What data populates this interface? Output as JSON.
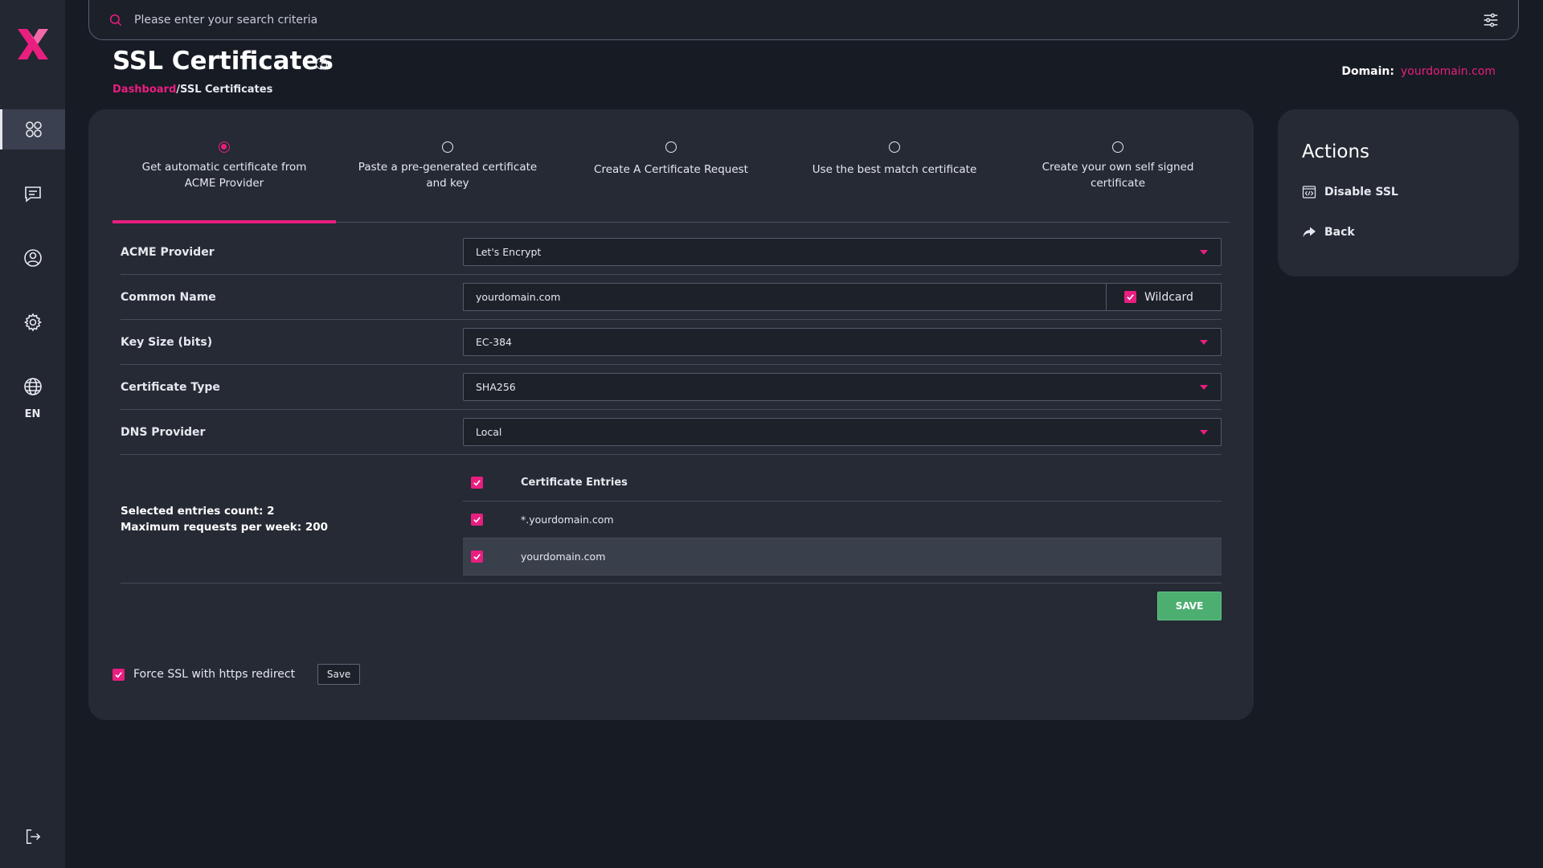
{
  "colors": {
    "accent": "#e91e7f",
    "save_green": "#4caf71",
    "background": "#171b24",
    "panel": "#252a34",
    "sidebar": "#222731"
  },
  "sidebar": {
    "logo_icon": "x-logo",
    "items": [
      {
        "name": "dashboard",
        "icon": "grid-icon",
        "active": true
      },
      {
        "name": "messages",
        "icon": "chat-icon",
        "active": false
      },
      {
        "name": "account",
        "icon": "user-icon",
        "active": false
      },
      {
        "name": "settings",
        "icon": "gear-icon",
        "active": false
      },
      {
        "name": "language",
        "icon": "globe-icon",
        "active": false
      }
    ],
    "language_label": "EN",
    "logout_icon": "logout-icon"
  },
  "search": {
    "placeholder": "Please enter your search criteria",
    "filter_icon": "sliders-icon"
  },
  "header": {
    "title": "SSL Certificates",
    "breadcrumb": {
      "link": "Dashboard",
      "separator": "/",
      "current": "SSL Certificates"
    },
    "domain_label": "Domain:",
    "domain_value": "yourdomain.com"
  },
  "steps": [
    {
      "label": "Get automatic certificate from ACME Provider",
      "active": true
    },
    {
      "label": "Paste a pre-generated certificate and key",
      "active": false
    },
    {
      "label": "Create A Certificate Request",
      "active": false
    },
    {
      "label": "Use the best match certificate",
      "active": false
    },
    {
      "label": "Create your own self signed certificate",
      "active": false
    }
  ],
  "form": {
    "acme_provider": {
      "label": "ACME Provider",
      "value": "Let's Encrypt"
    },
    "common_name": {
      "label": "Common Name",
      "value": "yourdomain.com",
      "wildcard_label": "Wildcard",
      "wildcard_checked": true
    },
    "key_size": {
      "label": "Key Size (bits)",
      "value": "EC-384"
    },
    "certificate_type": {
      "label": "Certificate Type",
      "value": "SHA256"
    },
    "dns_provider": {
      "label": "DNS Provider",
      "value": "Local"
    }
  },
  "entries": {
    "selected_count_text": "Selected entries count: 2",
    "max_requests_text": "Maximum requests per week: 200",
    "header": "Certificate Entries",
    "rows": [
      {
        "name": "*.yourdomain.com",
        "checked": true
      },
      {
        "name": "yourdomain.com",
        "checked": true
      }
    ]
  },
  "save_button": "SAVE",
  "force_ssl": {
    "label": "Force SSL with https redirect",
    "checked": true,
    "save_label": "Save"
  },
  "actions": {
    "title": "Actions",
    "items": [
      {
        "label": "Disable SSL",
        "icon": "code-window-icon"
      },
      {
        "label": "Back",
        "icon": "share-arrow-icon"
      }
    ]
  }
}
